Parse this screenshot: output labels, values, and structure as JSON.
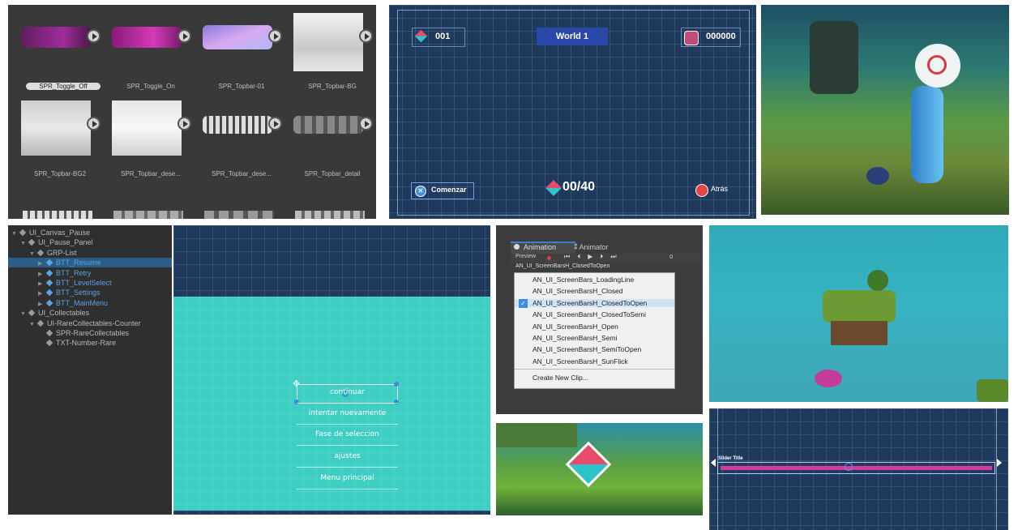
{
  "sprite_browser": {
    "items": [
      {
        "label": "SPR_Toggle_Off",
        "selected": true
      },
      {
        "label": "SPR_Toggle_On",
        "selected": false
      },
      {
        "label": "SPR_Topbar-01",
        "selected": false
      },
      {
        "label": "SPR_Topbar-BG",
        "selected": false
      },
      {
        "label": "SPR_Topbar-BG2",
        "selected": false
      },
      {
        "label": "SPR_Topbar_dese...",
        "selected": false
      },
      {
        "label": "SPR_Topbar_dese...",
        "selected": false
      },
      {
        "label": "SPR_Topbar_detail",
        "selected": false
      }
    ]
  },
  "world_hud": {
    "gems": "001",
    "world_title": "World 1",
    "score": "000000",
    "start_label": "Comenzar",
    "collect_counter": "00/40",
    "back_label": "Atrás"
  },
  "hierarchy": {
    "rows": [
      {
        "label": "UI_Canvas_Pause",
        "depth": 0,
        "expanded": true,
        "blue": false,
        "selected": false,
        "arrow": true
      },
      {
        "label": "UI_Pause_Panel",
        "depth": 1,
        "expanded": true,
        "blue": false,
        "selected": false,
        "arrow": true
      },
      {
        "label": "GRP-List",
        "depth": 2,
        "expanded": true,
        "blue": false,
        "selected": false,
        "arrow": true
      },
      {
        "label": "BTT_Resume",
        "depth": 3,
        "expanded": false,
        "blue": true,
        "selected": true,
        "arrow": true
      },
      {
        "label": "BTT_Retry",
        "depth": 3,
        "expanded": false,
        "blue": true,
        "selected": false,
        "arrow": true
      },
      {
        "label": "BTT_LevelSelect",
        "depth": 3,
        "expanded": false,
        "blue": true,
        "selected": false,
        "arrow": true
      },
      {
        "label": "BTT_Settings",
        "depth": 3,
        "expanded": false,
        "blue": true,
        "selected": false,
        "arrow": true
      },
      {
        "label": "BTT_MainMenu",
        "depth": 3,
        "expanded": false,
        "blue": true,
        "selected": false,
        "arrow": true
      },
      {
        "label": "UI_Collectables",
        "depth": 1,
        "expanded": true,
        "blue": false,
        "selected": false,
        "arrow": true
      },
      {
        "label": "UI-RareCollectables-Counter",
        "depth": 2,
        "expanded": true,
        "blue": false,
        "selected": false,
        "arrow": true
      },
      {
        "label": "SPR-RareCollectables",
        "depth": 3,
        "expanded": false,
        "blue": false,
        "selected": false,
        "arrow": false
      },
      {
        "label": "TXT-Number-Rare",
        "depth": 3,
        "expanded": false,
        "blue": false,
        "selected": false,
        "arrow": false
      }
    ]
  },
  "pause_menu": {
    "items": [
      "continuar",
      "intentar nuevamente",
      "Fase de seleccion",
      "ajustes",
      "Menu principal"
    ]
  },
  "animation": {
    "tab_animation": "Animation",
    "tab_animator": "Animator",
    "preview_label": "Preview",
    "frame": "0",
    "current_clip": "AN_UI_ScreenBarsH_ClosedToOpen",
    "clips": [
      "AN_UI_ScreenBars_LoadingLine",
      "AN_UI_ScreenBarsH_Closed",
      "AN_UI_ScreenBarsH_ClosedToOpen",
      "AN_UI_ScreenBarsH_ClosedToSemi",
      "AN_UI_ScreenBarsH_Open",
      "AN_UI_ScreenBarsH_Semi",
      "AN_UI_ScreenBarsH_SemiToOpen",
      "AN_UI_ScreenBarsH_SunFlick"
    ],
    "checked_index": 2,
    "create_label": "Create New Clip..."
  },
  "slider": {
    "title": "Slider Title",
    "value": 0.47,
    "bar_color": "#d63aa0"
  },
  "colors": {
    "editor_dark": "#393939",
    "scene_grid": "#1f3a5c",
    "pause_bg": "#3ecfc2",
    "selection": "#2c5d87"
  }
}
